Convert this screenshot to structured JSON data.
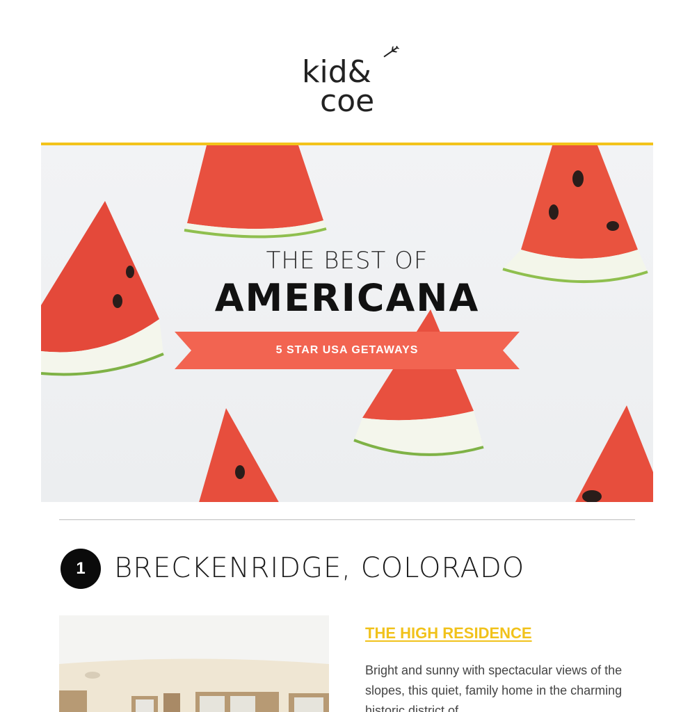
{
  "brand": {
    "logo_text_line1": "kid&",
    "logo_text_line2": "coe"
  },
  "hero": {
    "line1": "THE BEST OF",
    "line2": "AMERICANA",
    "ribbon_label": "5 STAR USA GETAWAYS"
  },
  "section": {
    "number": "1",
    "title": "BRECKENRIDGE, COLORADO"
  },
  "listing": {
    "name": "THE HIGH RESIDENCE",
    "description": "Bright and sunny with spectacular views of the slopes, this quiet, family home in the charming historic district of"
  },
  "colors": {
    "accent_yellow": "#f3c31b",
    "ribbon_coral": "#f26451",
    "watermelon_red": "#e8503f",
    "rind_green": "#8fbf4e"
  },
  "icons": {
    "logo_plane": "airplane-icon"
  }
}
